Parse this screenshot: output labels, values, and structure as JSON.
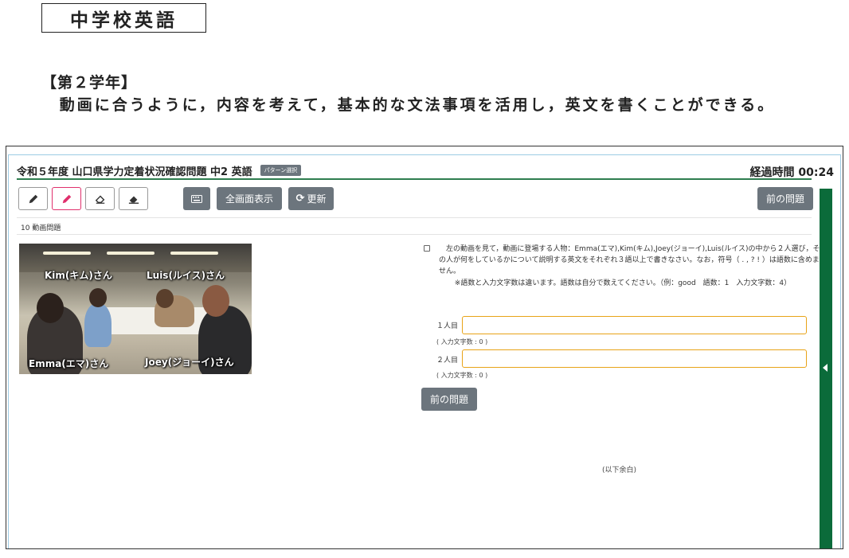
{
  "document": {
    "subject": "中学校英語",
    "grade": "【第２学年】",
    "description": "動画に合うように，内容を考えて，基本的な文法事項を活用し，英文を書くことができる。"
  },
  "app": {
    "title": "令和５年度 山口県学力定着状況確認問題 中2  英語",
    "pattern_badge": "パターン選択",
    "elapsed": "経過時間 00:24"
  },
  "toolbar": {
    "fullscreen_label": "全画面表示",
    "refresh_label": "更新",
    "prev_label": "前の問題"
  },
  "question": {
    "label": "10  動画問題",
    "text": "左の動画を見て，動画に登場する人物：Emma(エマ),Kim(キム),Joey(ジョーイ),Luis(ルイス)の中から２人選び，その人が何をしているかについて説明する英文をそれぞれ３語以上で書きなさい。なお，符号（ . , ? ! ）は語数に含めません。",
    "note": "※語数と入力文字数は違います。語数は自分で数えてください。（例：good　語数：1　入力文字数：4）",
    "answer1_label": "１人目",
    "answer1_count": "( 入力文字数 : 0 )",
    "answer2_label": "２人目",
    "answer2_count": "( 入力文字数 : 0 )",
    "prev_label": "前の問題",
    "remaining": "(以下余白)"
  },
  "video": {
    "kim": "Kim(キム)さん",
    "luis": "Luis(ルイス)さん",
    "emma": "Emma(エマ)さん",
    "joey": "Joey(ジョーイ)さん"
  },
  "colors": {
    "accent_green": "#0b6b3a",
    "input_border": "#e8a317",
    "button_gray": "#6c757d",
    "pen_pink": "#e0306d"
  }
}
